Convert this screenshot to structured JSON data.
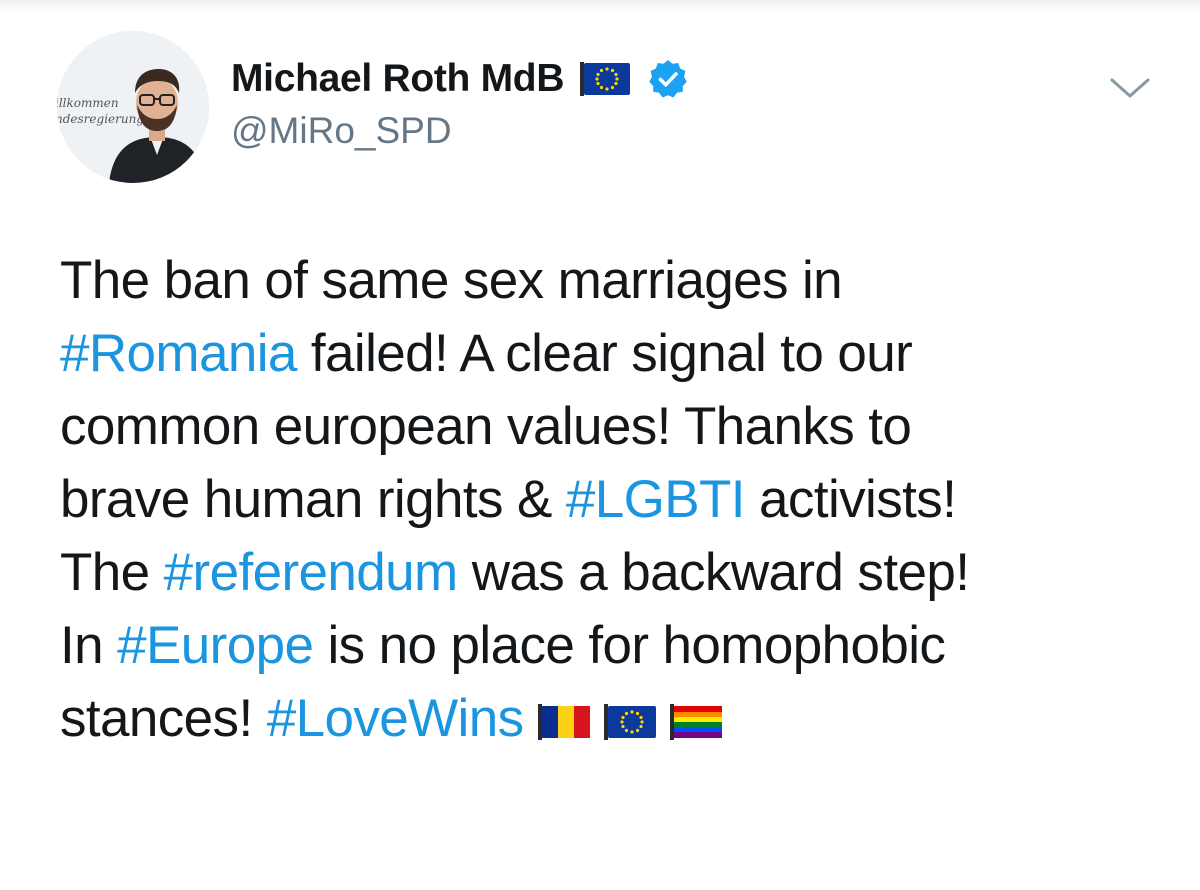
{
  "author": {
    "display_name": "Michael Roth MdB",
    "handle": "@MiRo_SPD",
    "avatar_text_line1": "illkommen",
    "avatar_text_line2": "ndesregierung"
  },
  "icons": {
    "name_flag": "eu-flag-icon",
    "verified": "verified-badge-icon",
    "caret": "chevron-down-icon"
  },
  "colors": {
    "hashtag": "#1b95e0",
    "secondary_text": "#657786",
    "primary_text": "#14171a",
    "verified": "#1da1f2"
  },
  "tweet": {
    "line1": "The ban of same sex marriages in",
    "line2_tag": "#Romania",
    "line2_text": " failed! A clear signal to our",
    "line3": "common european values! Thanks to",
    "line4_text": "brave human rights & ",
    "line4_tag": "#LGBTI",
    "line4_after": " activists!",
    "line5_text": "The ",
    "line5_tag": "#referendum",
    "line5_after": " was a backward step!",
    "line6_text": "In ",
    "line6_tag": "#Europe",
    "line6_after": " is no place for homophobic",
    "line7_text": "stances! ",
    "line7_tag": "#LoveWins",
    "emojis": [
      "romania-flag-icon",
      "eu-flag-icon",
      "rainbow-flag-icon"
    ]
  }
}
